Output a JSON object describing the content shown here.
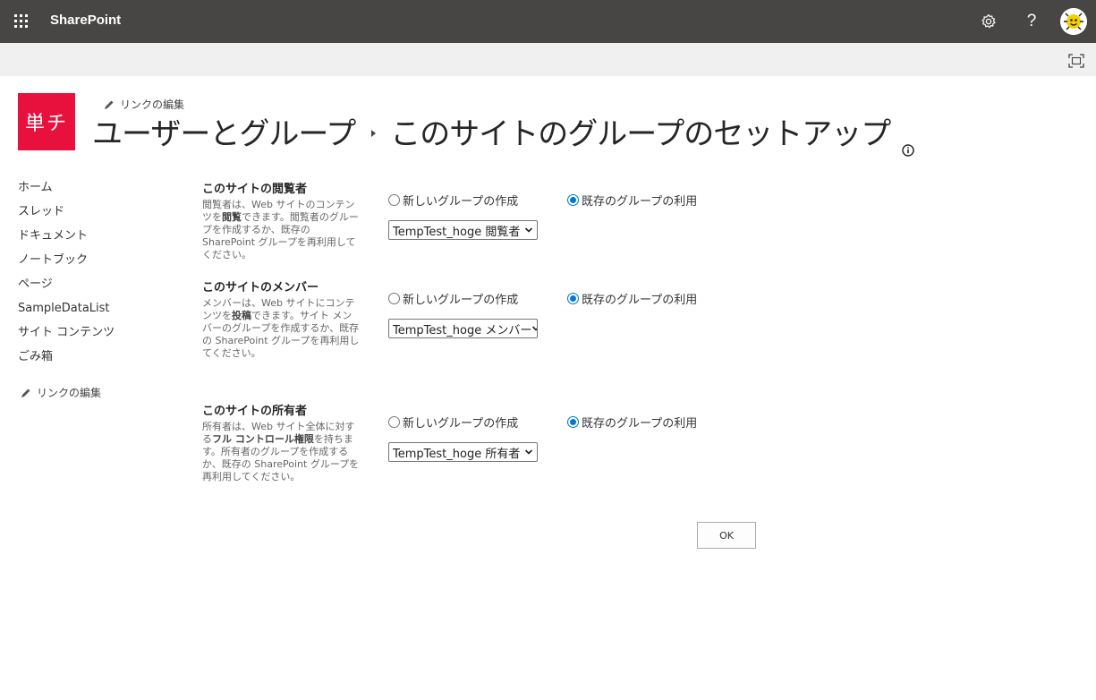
{
  "suite_bar": {
    "app_name": "SharePoint",
    "waffle_icon": "app-launcher-icon",
    "settings_icon": "gear-icon",
    "help_label": "?",
    "avatar_icon": "user-avatar"
  },
  "site": {
    "logo_text": "単チ",
    "logo_color": "#e8103c",
    "edit_links_label": "リンクの編集",
    "breadcrumb": {
      "parent": "ユーザーとグループ",
      "current": "このサイトのグループのセットアップ"
    }
  },
  "nav": {
    "items": [
      {
        "label": "ホーム"
      },
      {
        "label": "スレッド"
      },
      {
        "label": "ドキュメント"
      },
      {
        "label": "ノートブック"
      },
      {
        "label": "ページ"
      },
      {
        "label": "SampleDataList"
      },
      {
        "label": "サイト コンテンツ"
      },
      {
        "label": "ごみ箱"
      }
    ],
    "edit_links_label": "リンクの編集"
  },
  "sections": [
    {
      "title": "このサイトの閲覧者",
      "desc_pre": "閲覧者は、Web サイトのコンテンツを",
      "desc_bold": "閲覧",
      "desc_post": "できます。閲覧者のグループを作成するか、既存の SharePoint グループを再利用してください。",
      "option_new": "新しいグループの作成",
      "option_existing": "既存のグループの利用",
      "selected_option": "existing",
      "selected_group": "TempTest_hoge 閲覧者"
    },
    {
      "title": "このサイトのメンバー",
      "desc_pre": "メンバーは、Web サイトにコンテンツを",
      "desc_bold": "投稿",
      "desc_post": "できます。サイト メンバーのグループを作成するか、既存の SharePoint グループを再利用してください。",
      "option_new": "新しいグループの作成",
      "option_existing": "既存のグループの利用",
      "selected_option": "existing",
      "selected_group": "TempTest_hoge メンバー"
    },
    {
      "title": "このサイトの所有者",
      "desc_pre": "所有者は、Web サイト全体に対する",
      "desc_bold": "フル コントロール権限",
      "desc_post": "を持ちます。所有者のグループを作成するか、既存の SharePoint グループを再利用してください。",
      "option_new": "新しいグループの作成",
      "option_existing": "既存のグループの利用",
      "selected_option": "existing",
      "selected_group": "TempTest_hoge 所有者"
    }
  ],
  "ok_label": "OK",
  "colors": {
    "suite_bar": "#484644",
    "accent": "#0078d4",
    "command_bar": "#f0f0f0"
  }
}
